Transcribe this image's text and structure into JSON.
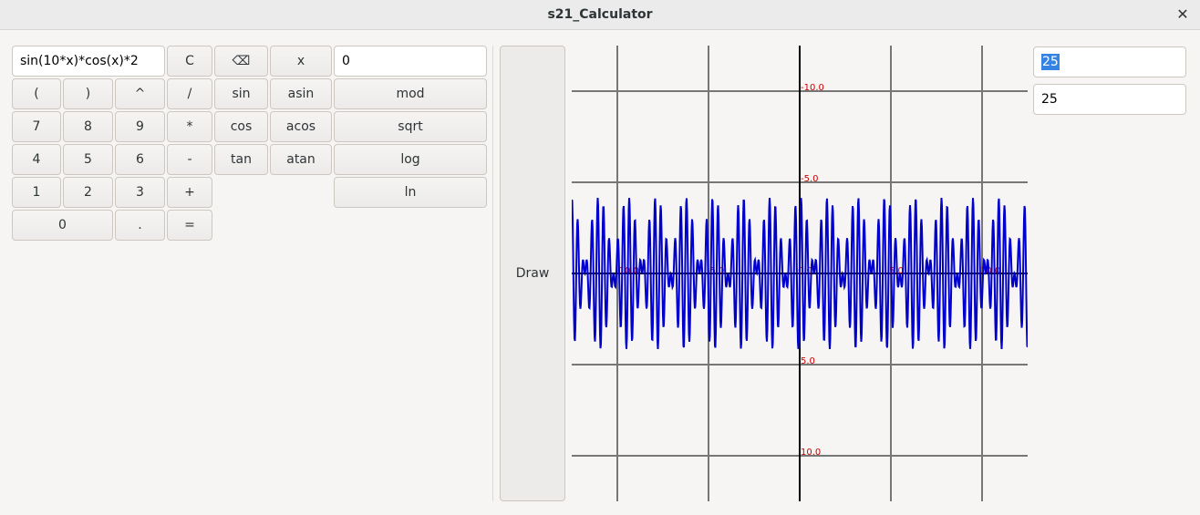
{
  "window": {
    "title": "s21_Calculator",
    "close_glyph": "✕"
  },
  "calc": {
    "expression": "sin(10*x)*cos(x)*2",
    "x_value": "0",
    "keys": {
      "clear": "C",
      "backspace": "⌫",
      "x": "x",
      "lparen": "(",
      "rparen": ")",
      "pow": "^",
      "div": "/",
      "sin": "sin",
      "asin": "asin",
      "mod": "mod",
      "seven": "7",
      "eight": "8",
      "nine": "9",
      "mul": "*",
      "cos": "cos",
      "acos": "acos",
      "sqrt": "sqrt",
      "four": "4",
      "five": "5",
      "six": "6",
      "minus": "-",
      "tan": "tan",
      "atan": "atan",
      "log": "log",
      "one": "1",
      "two": "2",
      "three": "3",
      "plus": "+",
      "ln": "ln",
      "zero": "0",
      "dot": ".",
      "equals": "="
    }
  },
  "graph": {
    "draw_label": "Draw",
    "x_range": "25",
    "y_range": "25",
    "function_color": "#0000cc",
    "label_color": "#cc0000",
    "y_tick_labels": [
      "-10.0",
      "-5.0",
      "5.0",
      "10.0"
    ],
    "x_tick_labels": [
      "-10.0",
      "-5.0",
      "0.0",
      "5.0",
      "10.0"
    ]
  }
}
